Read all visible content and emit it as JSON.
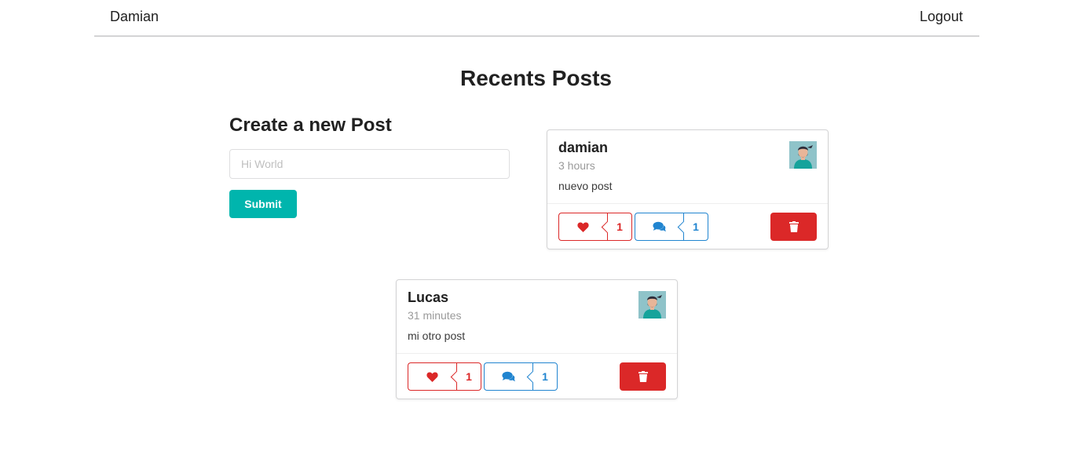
{
  "nav": {
    "username": "Damian",
    "logout_label": "Logout"
  },
  "page": {
    "title": "Recents Posts"
  },
  "form": {
    "title": "Create a new Post",
    "placeholder": "Hi World",
    "value": "",
    "submit_label": "Submit"
  },
  "posts": [
    {
      "author": "damian",
      "time": "3 hours",
      "body": "nuevo post",
      "likes": "1",
      "comments": "1"
    },
    {
      "author": "Lucas",
      "time": "31 minutes",
      "body": "mi otro post",
      "likes": "1",
      "comments": "1"
    }
  ],
  "colors": {
    "accent": "#00b5ad",
    "like": "#db2828",
    "comment": "#2185d0",
    "delete": "#db2828"
  },
  "icons": {
    "like": "heart-icon",
    "comment": "comments-icon",
    "delete": "trash-icon",
    "avatar": "avatar-image"
  }
}
